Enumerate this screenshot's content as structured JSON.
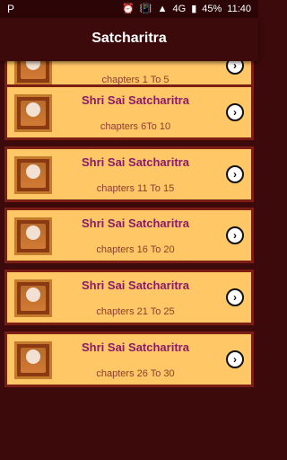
{
  "status": {
    "left_icon": "notification-p-icon",
    "battery": "45%",
    "time": "11:40",
    "network": "4G"
  },
  "appbar": {
    "title": "Satcharitra"
  },
  "items": [
    {
      "title": "",
      "subtitle": "chapters 1 To 5"
    },
    {
      "title": "Shri Sai Satcharitra",
      "subtitle": "chapters 6To 10"
    },
    {
      "title": "Shri Sai Satcharitra",
      "subtitle": "chapters 11 To 15"
    },
    {
      "title": "Shri Sai Satcharitra",
      "subtitle": "chapters 16 To 20"
    },
    {
      "title": "Shri Sai Satcharitra",
      "subtitle": "chapters 21 To 25"
    },
    {
      "title": "Shri Sai Satcharitra",
      "subtitle": "chapters 26 To 30"
    }
  ],
  "colors": {
    "appbar_bg": "#3d0a0b",
    "card_bg": "#ffc766",
    "card_border": "#7d1e14",
    "title_text": "#8b1a6b",
    "subtitle_text": "#8b3e2f"
  }
}
